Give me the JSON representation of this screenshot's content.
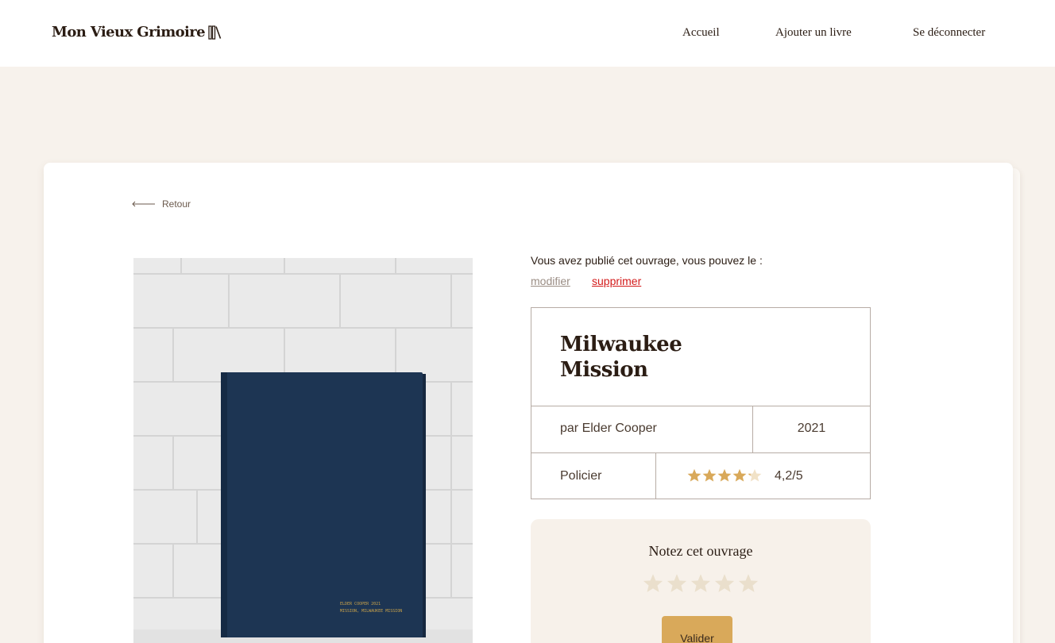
{
  "header": {
    "logo_text": "Mon Vieux Grimoire",
    "logo_icon": "books-icon",
    "nav": [
      {
        "label": "Accueil"
      },
      {
        "label": "Ajouter un livre"
      },
      {
        "label": "Se déconnecter"
      }
    ]
  },
  "back": {
    "label": "Retour",
    "icon": "arrow-left-icon"
  },
  "owner": {
    "message": "Vous avez publié cet ouvrage, vous pouvez le :",
    "modify_label": "modifier",
    "delete_label": "supprimer"
  },
  "book": {
    "title_line1": "Milwaukee",
    "title_line2": "Mission",
    "author": "par Elder Cooper",
    "year": "2021",
    "genre": "Policier",
    "rating_value": 4.2,
    "rating_max": 5,
    "rating_text": "4,2/5",
    "cover_spine_line1": "ELDER COOPER 2021",
    "cover_spine_line2": "MISSION, MILWAUKEE MISSION"
  },
  "rating_form": {
    "heading": "Notez cet ouvrage",
    "star_count": 5,
    "submit_label": "Valider"
  },
  "colors": {
    "page_background": "#f7f2ec",
    "accent_gold": "#d9a95a",
    "delete_red": "#d31a1a",
    "book_cover_navy": "#1d3553"
  }
}
